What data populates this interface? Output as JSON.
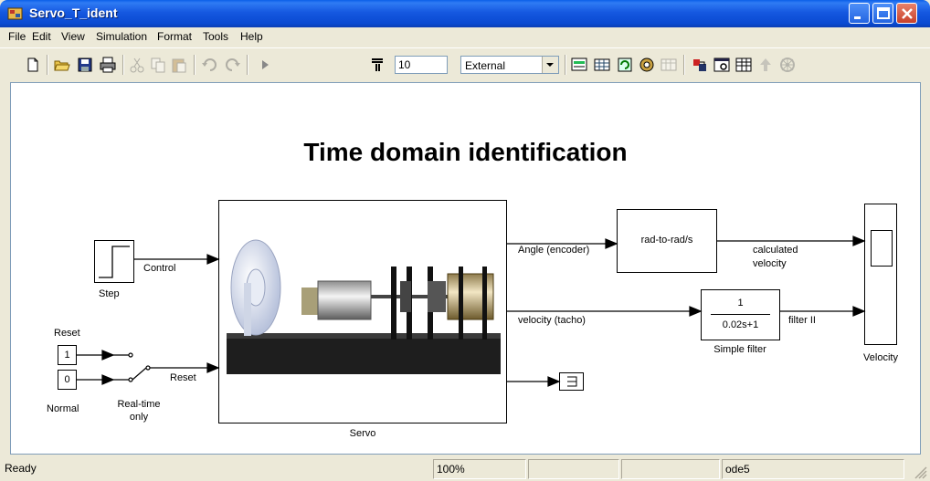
{
  "window": {
    "title": "Servo_T_ident"
  },
  "menu": {
    "items": [
      "File",
      "Edit",
      "View",
      "Simulation",
      "Format",
      "Tools",
      "Help"
    ]
  },
  "toolbar": {
    "stop_time": "10",
    "sim_mode": "External",
    "icons": [
      "new-icon",
      "open-icon",
      "save-icon",
      "print-icon",
      "cut-icon",
      "copy-icon",
      "paste-icon",
      "undo-icon",
      "redo-icon",
      "start-icon",
      "pause-icon",
      "build-icon",
      "connect-icon",
      "library-icon",
      "model-browser-icon",
      "debug-icon",
      "diagnostics-icon",
      "help-icon"
    ]
  },
  "diagram": {
    "title": "Time domain identification",
    "blocks": {
      "servo": {
        "name": "Servo"
      },
      "step": {
        "name": "Step"
      },
      "reset_const": {
        "value": "1",
        "label": "Reset"
      },
      "normal_const": {
        "value": "0",
        "label": "Normal"
      },
      "switch": {
        "name_line1": "Real-time",
        "name_line2": "only"
      },
      "rad_to_rads": {
        "text": "rad-to-rad/s"
      },
      "simple_filter": {
        "numerator": "1",
        "denominator": "0.02s+1",
        "name": "Simple filter"
      },
      "velocity_scope": {
        "name": "Velocity"
      }
    },
    "signals": {
      "control": "Control",
      "reset": "Reset",
      "angle": "Angle (encoder)",
      "velocity_tacho": "velocity (tacho)",
      "calculated_line1": "calculated",
      "calculated_line2": "velocity",
      "filter": "filter II"
    }
  },
  "status": {
    "state": "Ready",
    "zoom": "100%",
    "solver": "ode5"
  }
}
